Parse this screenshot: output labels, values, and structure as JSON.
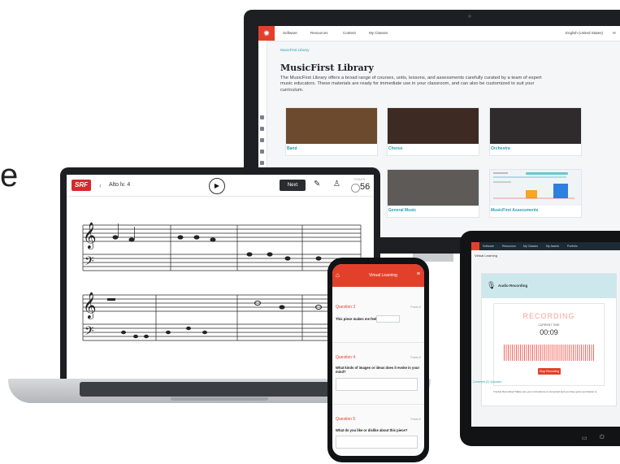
{
  "stray_letter": "e",
  "desktop": {
    "nav": [
      "Software",
      "Resources",
      "Content",
      "My Classes"
    ],
    "language": "English (United States)",
    "breadcrumb": "MusicFirst Library",
    "title": "MusicFirst Library",
    "description": "The MusicFirst Library offers a broad range of courses, units, lessons, and assessments carefully curated by a team of expert music educators. These materials are ready for immediate use in your classroom, and can also be customized to suit your curriculum.",
    "tiles": [
      {
        "label": "Band",
        "color": "#6b4a2e"
      },
      {
        "label": "Chorus",
        "color": "#3d2a22"
      },
      {
        "label": "Orchestra",
        "color": "#2f2a2c"
      },
      {
        "label": "General Music",
        "color": "#5d5a57"
      },
      {
        "label": "MusicFirst Assessments",
        "color": "#f1f4f6"
      }
    ]
  },
  "laptop": {
    "logo": "SRF",
    "back_glyph": "‹",
    "level": "Alto lv. 4",
    "play_glyph": "▶",
    "next_label": "Next",
    "score_label": "POINTS",
    "score": "56",
    "tool_icons": [
      "pencil-icon",
      "metronome-icon"
    ]
  },
  "phone": {
    "title": "Virtual Learning",
    "home_glyph": "⌂",
    "menu_glyph": "≡",
    "questions": [
      {
        "label": "Question 3",
        "points": "Points 5",
        "prompt": "This piece makes me feel"
      },
      {
        "label": "Question 4",
        "points": "Points 5",
        "prompt": "What kinds of images or ideas does it evoke in your mind?"
      },
      {
        "label": "Question 5",
        "points": "Points 5",
        "prompt": "What do you like or dislike about this piece?"
      }
    ]
  },
  "tablet": {
    "nav": [
      "Software",
      "Resources",
      "My Classes",
      "My Assets",
      "Portfolio"
    ],
    "breadcrumb": "Virtual Learning",
    "card_title": "Audio Recording",
    "recording_label": "RECORDING",
    "current_time_label": "CURRENT TIME",
    "time": "00:09",
    "stop_label": "Stop Recording",
    "note": "Trouble Recording? Make sure your microphone is connected and you have given permission to",
    "question_link": "Comment (2) Question"
  }
}
